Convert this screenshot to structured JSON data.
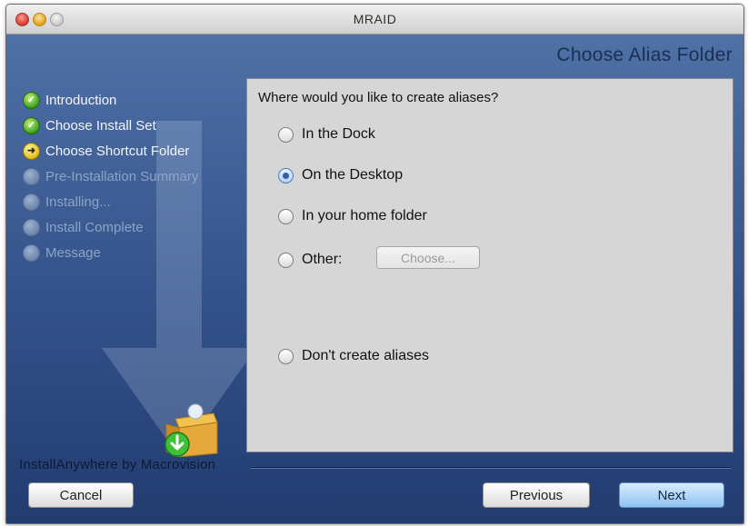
{
  "window": {
    "title": "MRAID"
  },
  "header": {
    "heading": "Choose Alias Folder"
  },
  "steps": [
    {
      "label": "Introduction",
      "state": "done"
    },
    {
      "label": "Choose Install Set",
      "state": "done"
    },
    {
      "label": "Choose Shortcut Folder",
      "state": "current"
    },
    {
      "label": "Pre-Installation Summary",
      "state": "pending"
    },
    {
      "label": "Installing...",
      "state": "pending"
    },
    {
      "label": "Install Complete",
      "state": "pending"
    },
    {
      "label": "Message",
      "state": "pending"
    }
  ],
  "panel": {
    "question": "Where would you like to create aliases?",
    "options": [
      {
        "label": "In the Dock",
        "checked": false
      },
      {
        "label": "On the Desktop",
        "checked": true
      },
      {
        "label": "In your home folder",
        "checked": false
      },
      {
        "label": "Other:",
        "checked": false
      },
      {
        "label": "Don't create aliases",
        "checked": false
      }
    ],
    "choose_label": "Choose..."
  },
  "footer": {
    "branding": "InstallAnywhere by Macrovision",
    "cancel_label": "Cancel",
    "previous_label": "Previous",
    "next_label": "Next"
  },
  "colors": {
    "accent": "#2b5fb0",
    "sidebar_bg": "#3a5a93",
    "panel_bg": "#d6d6d6"
  },
  "icons": {
    "step_done": "check-circle-icon",
    "step_current": "arrow-right-circle-icon",
    "step_pending": "empty-circle-icon"
  }
}
